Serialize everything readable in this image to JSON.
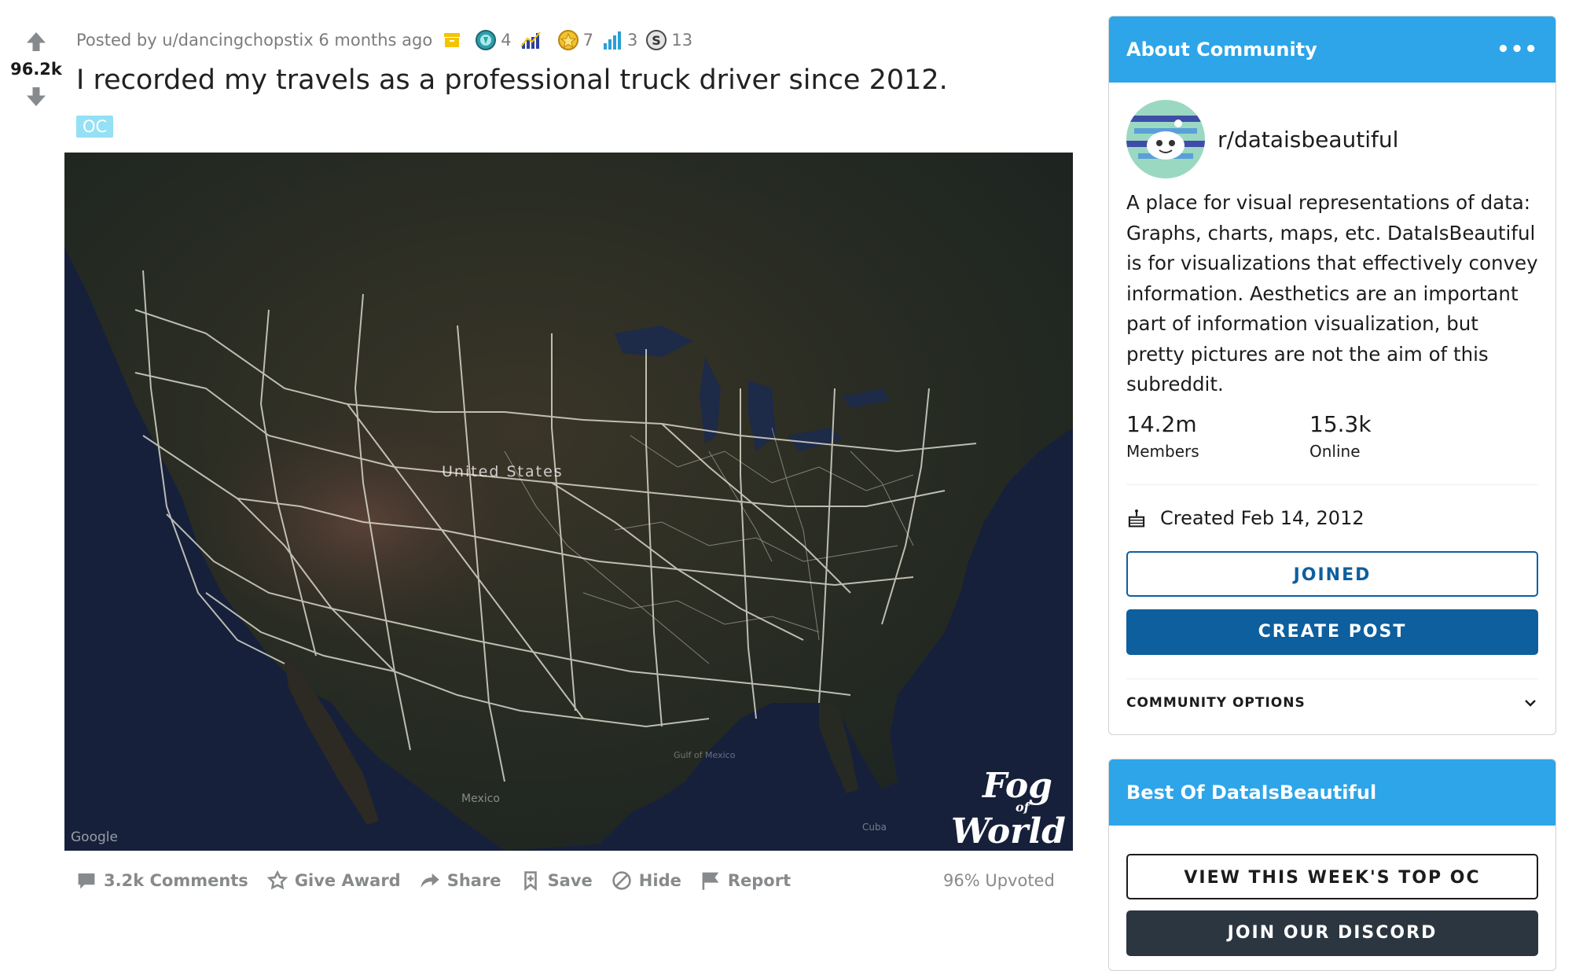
{
  "post": {
    "score": "96.2k",
    "posted_by": "Posted by u/dancingchopstix 6 months ago",
    "awards": [
      {
        "icon": "platinum-award-icon",
        "count": "4"
      },
      {
        "icon": "wholesome-chart-award-icon",
        "count": ""
      },
      {
        "icon": "gold-award-icon",
        "count": "7"
      },
      {
        "icon": "bar-chart-award-icon",
        "count": "3"
      },
      {
        "icon": "silver-award-icon",
        "count": "13"
      }
    ],
    "title": "I recorded my travels as a professional truck driver since 2012.",
    "flair": "OC",
    "map": {
      "country_label": "United States",
      "mexico_label": "Mexico",
      "gulf_label": "Gulf of Mexico",
      "cuba_label": "Cuba",
      "google_label": "Google",
      "watermark_line1": "Fog",
      "watermark_line2": "of",
      "watermark_line3": "World"
    },
    "actions": {
      "comments": "3.2k Comments",
      "give_award": "Give Award",
      "share": "Share",
      "save": "Save",
      "hide": "Hide",
      "report": "Report"
    },
    "upvoted": "96% Upvoted"
  },
  "sidebar": {
    "about": {
      "header": "About Community",
      "menu": "•••",
      "name": "r/dataisbeautiful",
      "description": "A place for visual representations of data: Graphs, charts, maps, etc. DataIsBeautiful is for visualizations that effectively convey information. Aesthetics are an important part of information visualization, but pretty pictures are not the aim of this subreddit.",
      "members_count": "14.2m",
      "members_label": "Members",
      "online_count": "15.3k",
      "online_label": "Online",
      "created": "Created Feb 14, 2012",
      "joined_button": "JOINED",
      "create_post_button": "CREATE POST",
      "community_options": "COMMUNITY OPTIONS"
    },
    "best_of": {
      "header": "Best Of DataIsBeautiful",
      "top_oc_button": "VIEW THIS WEEK'S TOP OC",
      "discord_button": "JOIN OUR DISCORD"
    }
  },
  "colors": {
    "header_blue": "#2da5e8",
    "button_blue": "#0d5f9e",
    "flair": "#94e0f4"
  }
}
